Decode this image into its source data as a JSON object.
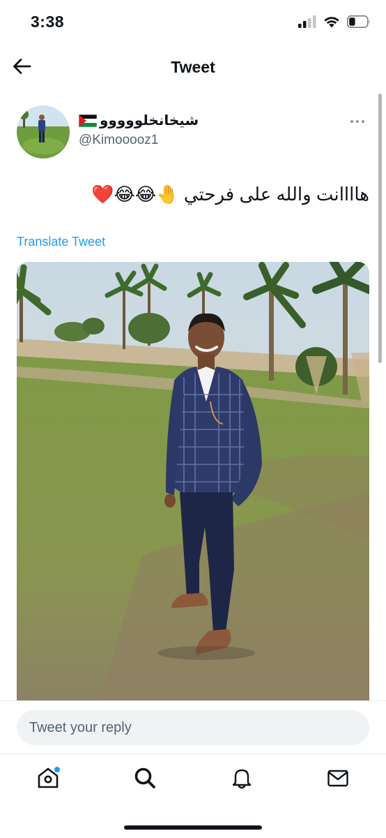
{
  "status_bar": {
    "time": "3:38",
    "icons": [
      "signal-icon",
      "wifi-icon",
      "battery-icon"
    ],
    "battery_level": 0.35
  },
  "header": {
    "title": "Tweet",
    "back_icon": "arrow-left-icon"
  },
  "tweet": {
    "display_name": "شيخانخلووووو",
    "username": "@Kimooooz1",
    "text": "هاااانت والله على فرحتي 🤚😂😂❤️",
    "translate_label": "Translate Tweet",
    "more_icon": "more-icon"
  },
  "reply": {
    "placeholder": "Tweet your reply"
  },
  "tab_bar": {
    "tabs": [
      "home-icon",
      "search-icon",
      "notifications-icon",
      "messages-icon"
    ]
  },
  "colors": {
    "accent": "#1d9bf0",
    "text_primary": "#0f1419",
    "text_secondary": "#536471",
    "input_bg": "#eff3f4"
  }
}
